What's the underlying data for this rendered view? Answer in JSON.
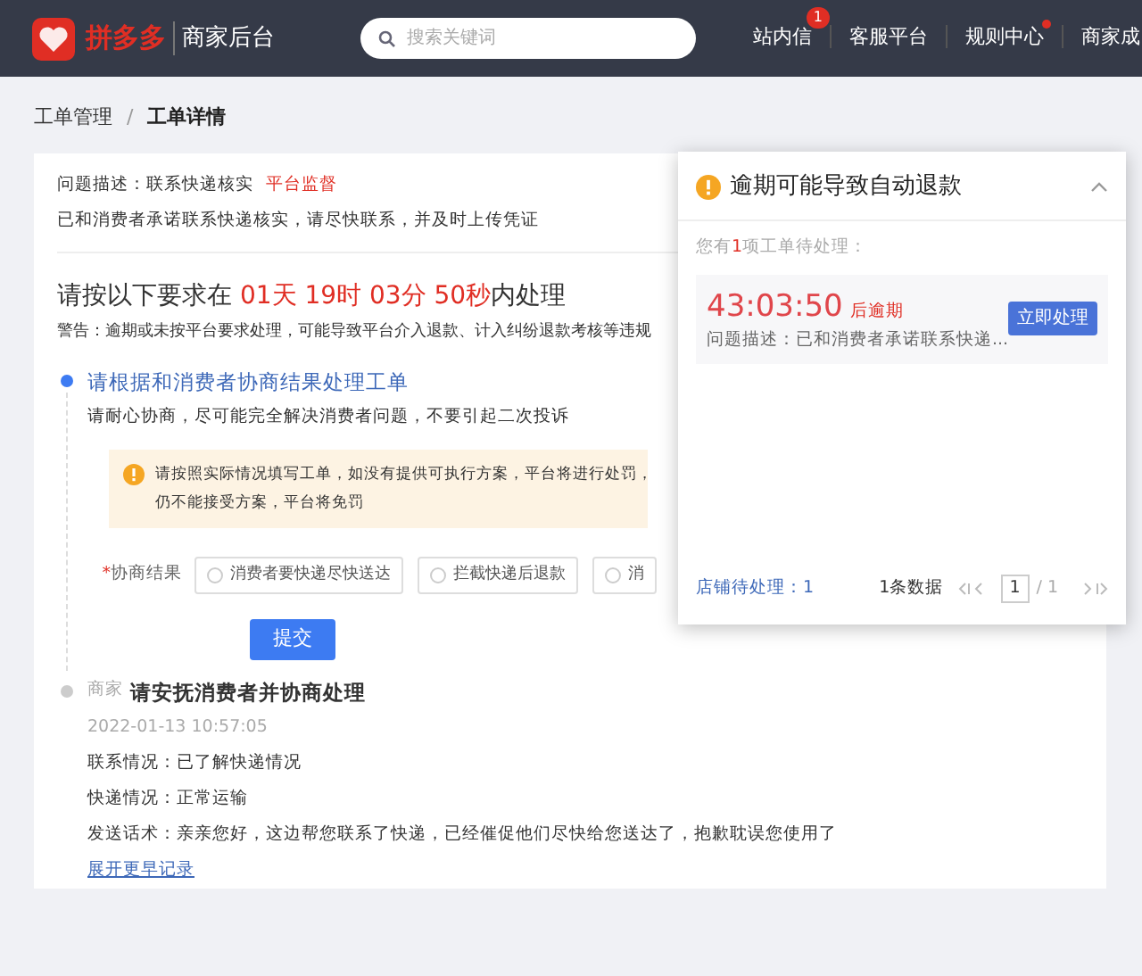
{
  "header": {
    "brand": "拼多多",
    "subtitle": "商家后台",
    "search": {
      "placeholder": "搜索关键词"
    },
    "nav": [
      {
        "label": "站内信",
        "badge": "1",
        "dot": false
      },
      {
        "label": "客服平台",
        "dot": false
      },
      {
        "label": "规则中心",
        "dot": true
      },
      {
        "label": "商家成",
        "dot": false
      }
    ]
  },
  "breadcrumb": [
    {
      "label": "工单管理",
      "selected": false
    },
    {
      "label": "工单详情",
      "selected": true
    }
  ],
  "breadcrumb_separator": "/",
  "issue": {
    "description": "问题描述：联系快递核实",
    "tag": "平台监督",
    "note": "已和消费者承诺联系快递核实，请尽快联系，并及时上传凭证"
  },
  "deadline": {
    "prefix": "请按以下要求在 ",
    "countdown": "01天 19时 03分 50秒",
    "suffix": "内处理",
    "warning": "警告：逾期或未按平台要求处理，可能导致平台介入退款、计入纠纷退款考核等违规"
  },
  "steps": [
    {
      "kind": "form",
      "active": true,
      "title": "请根据和消费者协商结果处理工单",
      "subtitle": "请耐心协商，尽可能完全解决消费者问题，不要引起二次投诉",
      "alert": [
        "请按照实际情况填写工单，如没有提供可执行方案，平台将进行处罚，",
        "仍不能接受方案，平台将免罚"
      ],
      "field_label": "协商结果",
      "required": true,
      "required_mark": "*",
      "options": [
        {
          "label": "消费者要快递尽快送达",
          "selected": false
        },
        {
          "label": "拦截快递后退款",
          "selected": false
        },
        {
          "label": "消",
          "selected": false
        }
      ],
      "submit": "提交"
    },
    {
      "kind": "record",
      "active": false,
      "role": "商家",
      "title": "请安抚消费者并协商处理",
      "time": "2022-01-13 10:57:05",
      "lines": [
        "联系情况：已了解快递情况",
        "快递情况：正常运输",
        "发送话术：亲亲您好，这边帮您联系了快递，已经催促他们尽快给您送达了，抱歉耽误您使用了"
      ],
      "more": "展开更早记录"
    }
  ],
  "popup": {
    "title": "逾期可能导致自动退款",
    "expanded": true,
    "summary_prefix": "您有",
    "count": "1",
    "summary_suffix": "项工单待处理：",
    "items": [
      {
        "countdown": "43:03:50",
        "countdown_suffix": "后逾期",
        "description": "问题描述：已和消费者承诺联系快递...",
        "action": "立即处理"
      }
    ],
    "footer": {
      "pending": "店铺待处理：1",
      "total": "1条数据",
      "page": "1",
      "pages": "/ 1"
    }
  }
}
